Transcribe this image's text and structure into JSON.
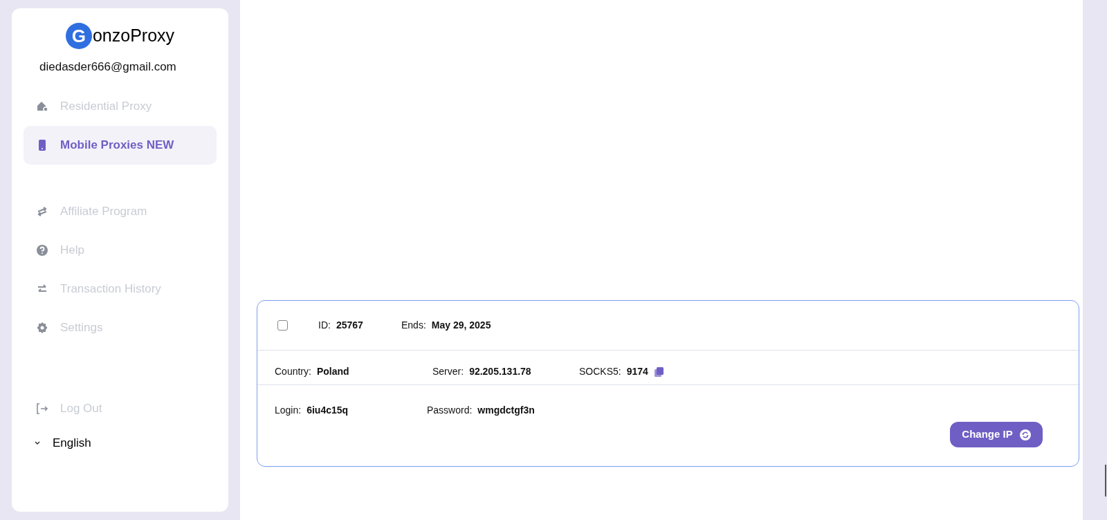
{
  "sidebar": {
    "logo": {
      "mark": "G",
      "text": "onzoProxy"
    },
    "email": "diedasder666@gmail.com",
    "items": [
      {
        "kind": "home",
        "label": "Residential Proxy",
        "selected": false
      },
      {
        "kind": "phone",
        "label": "Mobile Proxies NEW",
        "selected": true
      },
      {
        "kind": "affiliate",
        "label": "Affiliate Program",
        "selected": false
      },
      {
        "kind": "help",
        "label": "Help",
        "selected": false
      },
      {
        "kind": "transfer",
        "label": "Transaction History",
        "selected": false
      },
      {
        "kind": "settings",
        "label": "Settings",
        "selected": false
      }
    ],
    "logout": "Log Out",
    "language": "English"
  },
  "proxy_card": {
    "checked": false,
    "header": [
      {
        "label": "ID:",
        "value": "25767"
      },
      {
        "label": "Ends:",
        "value": "May 29, 2025"
      }
    ],
    "connection": [
      {
        "label": "Country:",
        "value": "Poland"
      },
      {
        "label": "Server:",
        "value": "92.205.131.78"
      },
      {
        "label": "SOCKS5:",
        "value": "9174",
        "copy": true
      }
    ],
    "credentials": [
      {
        "label": "Login:",
        "value": "6iu4c15q"
      },
      {
        "label": "Password:",
        "value": "wmgdctgf3n"
      }
    ],
    "button": "Change IP"
  }
}
